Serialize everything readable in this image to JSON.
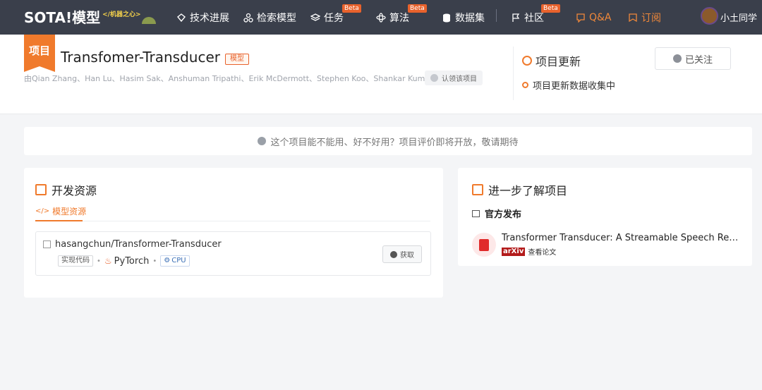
{
  "nav": {
    "logo_text": "SOTA!模型",
    "logo_sub": "</机器之心>",
    "items": [
      {
        "label": "技术进展",
        "icon": "diamond-icon"
      },
      {
        "label": "检索模型",
        "icon": "nodes-icon"
      },
      {
        "label": "任务",
        "icon": "layers-icon",
        "badge": "Beta"
      },
      {
        "label": "算法",
        "icon": "atom-icon",
        "badge": "Beta"
      },
      {
        "label": "数据集",
        "icon": "database-icon"
      },
      {
        "label": "社区",
        "icon": "flag-icon",
        "badge": "Beta"
      },
      {
        "label": "Q&A",
        "icon": "qa-icon"
      },
      {
        "label": "订阅",
        "icon": "bookmark-icon"
      }
    ],
    "user_name": "小土同学"
  },
  "project": {
    "badge": "项目",
    "title": "Transfomer-Transducer",
    "type_tag": "模型",
    "authors": "由Qian Zhang、Han Lu、Hasim Sak、Anshuman Tripathi、Erik McDermott、Stephen Koo、Shankar Kumar研发",
    "claim_label": "认领该项目"
  },
  "updates": {
    "title": "项目更新",
    "follow_label": "已关注",
    "status": "项目更新数据收集中"
  },
  "notice": {
    "text": "这个项目能不能用、好不好用？项目评价即将开放，敬请期待"
  },
  "dev_resources": {
    "title": "开发资源",
    "tab_label": "模型资源",
    "repo": {
      "name": "hasangchun/Transformer-Transducer",
      "tag": "实现代码",
      "framework": "PyTorch",
      "device": "CPU",
      "get_label": "获取"
    }
  },
  "learn_more": {
    "title": "进一步了解项目",
    "section": "官方发布",
    "paper_title": "Transformer Transducer: A Streamable Speech Recognition Model with Transformer Encoders and RNN-T Loss",
    "source": "arXiv",
    "view_label": "查看论文"
  },
  "colors": {
    "accent": "#f07a2c",
    "nav_bg": "#3a3f4b",
    "page_bg": "#f4f5f7"
  }
}
